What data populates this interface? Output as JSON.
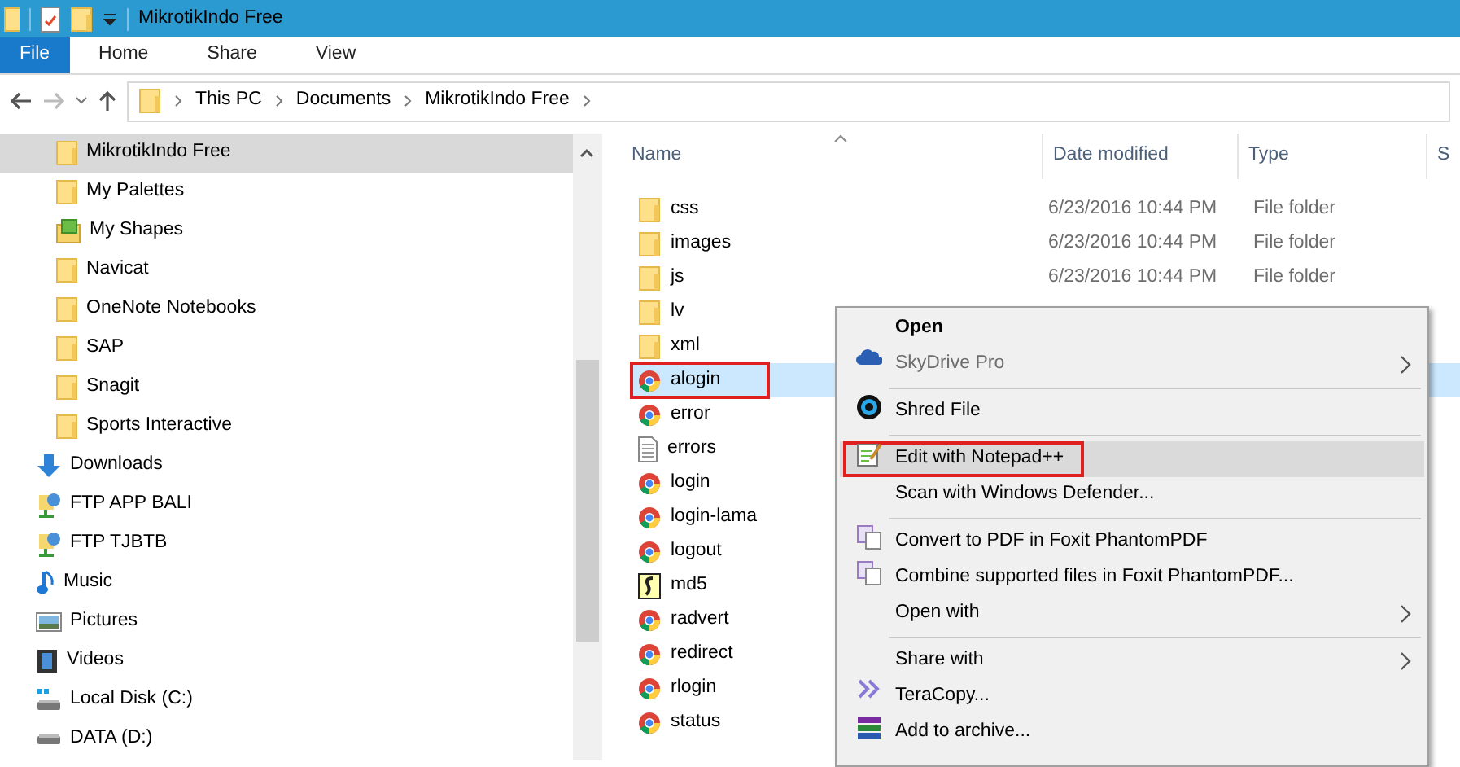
{
  "window": {
    "title": "MikrotikIndo Free"
  },
  "ribbon_tabs": [
    {
      "label": "File",
      "selected": true
    },
    {
      "label": "Home",
      "selected": false
    },
    {
      "label": "Share",
      "selected": false
    },
    {
      "label": "View",
      "selected": false
    }
  ],
  "address_bar": {
    "path": [
      "This PC",
      "Documents",
      "MikrotikIndo Free"
    ]
  },
  "sidebar": {
    "items": [
      {
        "children": [
          {
            "label": "MikrotikIndo Free",
            "kind": "folder",
            "selected": true
          },
          {
            "label": "My Palettes",
            "kind": "folder",
            "selected": false
          },
          {
            "label": "My Shapes",
            "kind": "shapes",
            "selected": false
          },
          {
            "label": "Navicat",
            "kind": "folder",
            "selected": false
          },
          {
            "label": "OneNote Notebooks",
            "kind": "folder",
            "selected": false
          },
          {
            "label": "SAP",
            "kind": "folder",
            "selected": false
          },
          {
            "label": "Snagit",
            "kind": "folder",
            "selected": false
          },
          {
            "label": "Sports Interactive",
            "kind": "folder",
            "selected": false
          }
        ]
      },
      {
        "label": "Downloads",
        "kind": "download",
        "selected": false
      },
      {
        "label": "FTP APP BALI",
        "kind": "ftp",
        "selected": false
      },
      {
        "label": "FTP TJBTB",
        "kind": "ftp",
        "selected": false
      },
      {
        "label": "Music",
        "kind": "music",
        "selected": false
      },
      {
        "label": "Pictures",
        "kind": "pictures",
        "selected": false
      },
      {
        "label": "Videos",
        "kind": "videos",
        "selected": false
      },
      {
        "label": "Local Disk (C:)",
        "kind": "disk",
        "selected": false
      },
      {
        "label": "DATA (D:)",
        "kind": "drive",
        "selected": false
      }
    ]
  },
  "table": {
    "columns": [
      "Name",
      "Date modified",
      "Type",
      "S"
    ],
    "rows": [
      {
        "name": "css",
        "kind": "folder",
        "date": "6/23/2016 10:44 PM",
        "type": "File folder",
        "selected": false,
        "outlined": false
      },
      {
        "name": "images",
        "kind": "folder",
        "date": "6/23/2016 10:44 PM",
        "type": "File folder",
        "selected": false,
        "outlined": false
      },
      {
        "name": "js",
        "kind": "folder",
        "date": "6/23/2016 10:44 PM",
        "type": "File folder",
        "selected": false,
        "outlined": false
      },
      {
        "name": "lv",
        "kind": "folder",
        "selected": false,
        "outlined": false
      },
      {
        "name": "xml",
        "kind": "folder",
        "selected": false,
        "outlined": false
      },
      {
        "name": "alogin",
        "kind": "chrome",
        "selected": true,
        "outlined": true
      },
      {
        "name": "error",
        "kind": "chrome",
        "selected": false,
        "outlined": false
      },
      {
        "name": "errors",
        "kind": "text",
        "selected": false,
        "outlined": false
      },
      {
        "name": "login",
        "kind": "chrome",
        "selected": false,
        "outlined": false
      },
      {
        "name": "login-lama",
        "kind": "chrome",
        "selected": false,
        "outlined": false
      },
      {
        "name": "logout",
        "kind": "chrome",
        "selected": false,
        "outlined": false
      },
      {
        "name": "md5",
        "kind": "script",
        "selected": false,
        "outlined": false
      },
      {
        "name": "radvert",
        "kind": "chrome",
        "selected": false,
        "outlined": false
      },
      {
        "name": "redirect",
        "kind": "chrome",
        "selected": false,
        "outlined": false
      },
      {
        "name": "rlogin",
        "kind": "chrome",
        "selected": false,
        "outlined": false
      },
      {
        "name": "status",
        "kind": "chrome",
        "selected": false,
        "outlined": false
      }
    ]
  },
  "context_menu": {
    "items": [
      {
        "kind": "default",
        "label": "Open",
        "disabled": false,
        "submenu": false,
        "selected": false,
        "outlined": false
      },
      {
        "kind": "cloud",
        "label": "SkyDrive Pro",
        "disabled": true,
        "submenu": true,
        "selected": false,
        "outlined": false
      },
      {
        "kind": "separator"
      },
      {
        "kind": "shred",
        "label": "Shred File",
        "disabled": false,
        "submenu": false,
        "selected": false,
        "outlined": false
      },
      {
        "kind": "separator"
      },
      {
        "kind": "notepad",
        "label": "Edit with Notepad++",
        "disabled": false,
        "submenu": false,
        "selected": true,
        "outlined": true
      },
      {
        "kind": "plain",
        "label": "Scan with Windows Defender...",
        "disabled": false,
        "submenu": false,
        "selected": false,
        "outlined": false
      },
      {
        "kind": "separator"
      },
      {
        "kind": "pdf",
        "label": "Convert to PDF in Foxit PhantomPDF",
        "disabled": false,
        "submenu": false,
        "selected": false,
        "outlined": false
      },
      {
        "kind": "pdf",
        "label": "Combine supported files in Foxit PhantomPDF...",
        "disabled": false,
        "submenu": false,
        "selected": false,
        "outlined": false
      },
      {
        "kind": "plain",
        "label": "Open with",
        "disabled": false,
        "submenu": true,
        "selected": false,
        "outlined": false
      },
      {
        "kind": "separator"
      },
      {
        "kind": "plain",
        "label": "Share with",
        "disabled": false,
        "submenu": true,
        "selected": false,
        "outlined": false
      },
      {
        "kind": "teracopy",
        "label": "TeraCopy...",
        "disabled": false,
        "submenu": false,
        "selected": false,
        "outlined": false
      },
      {
        "kind": "archive",
        "label": "Add to archive...",
        "disabled": false,
        "submenu": false,
        "selected": false,
        "outlined": false
      }
    ]
  }
}
